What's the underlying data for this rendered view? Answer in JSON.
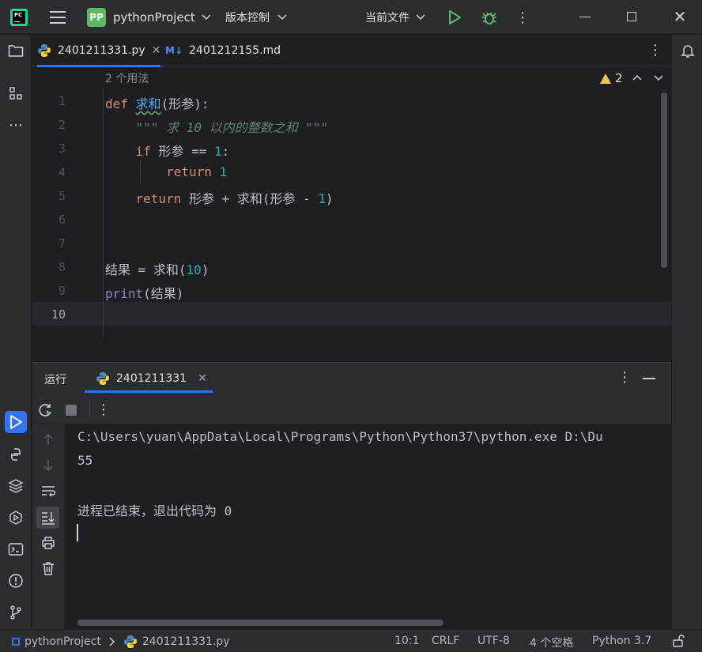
{
  "titlebar": {
    "project_badge": "PP",
    "project_name": "pythonProject",
    "vcs_label": "版本控制",
    "run_config": "当前文件"
  },
  "editor_tabs": [
    {
      "label": "2401211331.py",
      "icon": "python-icon",
      "active": true
    },
    {
      "label": "2401212155.md",
      "icon": "markdown-icon",
      "active": false
    }
  ],
  "editor": {
    "usages_hint": "2 个用法",
    "warning_count": "2",
    "line_numbers": [
      "1",
      "2",
      "3",
      "4",
      "5",
      "6",
      "7",
      "8",
      "9",
      "10"
    ],
    "code": {
      "l1_kw": "def",
      "l1_fn": "求和",
      "l1_rest": "(形参):",
      "l2_doc": "\"\"\" 求 10 以内的整数之和 \"\"\"",
      "l3_kw": "if",
      "l3_mid": " 形参 == ",
      "l3_num": "1",
      "l3_end": ":",
      "l4_kw": "return",
      "l4_num": "1",
      "l5_kw": "return",
      "l5_mid": " 形参 + 求和(形参 - ",
      "l5_num": "1",
      "l5_end": ")",
      "l8_a": "结果 = 求和(",
      "l8_num": "10",
      "l8_end": ")",
      "l9_builtin": "print",
      "l9_rest": "(结果)"
    }
  },
  "run_window": {
    "title": "运行",
    "tab_label": "2401211331",
    "console": {
      "command": "C:\\Users\\yuan\\AppData\\Local\\Programs\\Python\\Python37\\python.exe D:\\Du",
      "output": "55",
      "exit_message": "进程已结束，退出代码为 0"
    }
  },
  "statusbar": {
    "project": "pythonProject",
    "file": "2401211331.py",
    "position": "10:1",
    "line_ending": "CRLF",
    "encoding": "UTF-8",
    "indent": "4 个空格",
    "interpreter": "Python 3.7"
  },
  "colors": {
    "accent": "#3574f0",
    "keyword": "#cf8e6d",
    "number": "#2aacb8",
    "docstring": "#5f826b",
    "builtin": "#8888c6",
    "run_green": "#5fb865"
  }
}
